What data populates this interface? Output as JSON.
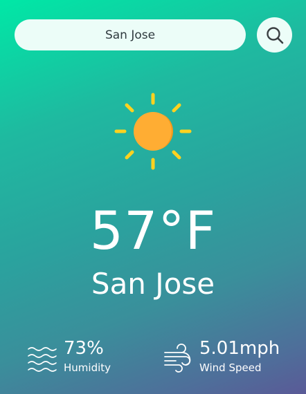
{
  "search": {
    "value": "San Jose",
    "icon": "search-icon"
  },
  "weather": {
    "icon": "sun-icon",
    "temperature": "57°F",
    "city": "San Jose"
  },
  "details": {
    "humidity": {
      "value": "73%",
      "label": "Humidity",
      "icon": "humidity-icon"
    },
    "wind": {
      "value": "5.01mph",
      "label": "Wind Speed",
      "icon": "wind-icon"
    }
  },
  "colors": {
    "gradient_start": "#00e8a6",
    "gradient_end": "#5a5a97",
    "search_bg": "#ecfdf8",
    "sun_rays": "#ffd21f",
    "sun_core": "#ffad33"
  }
}
